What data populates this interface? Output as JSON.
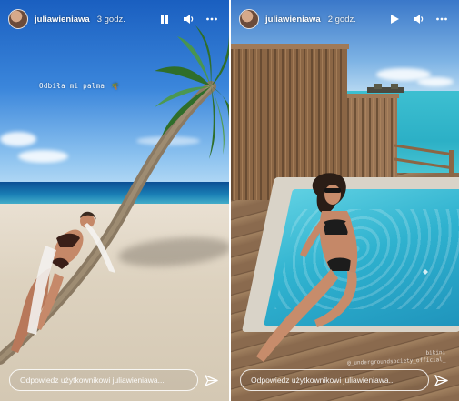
{
  "stories": [
    {
      "username": "juliawieniawa",
      "time": "3 godz.",
      "sticker_text": "Odbiła mi palma",
      "sticker_emoji": "🌴",
      "reply_placeholder": "Odpowiedz użytkownikowi juliawieniawa...",
      "controls": [
        "pause-icon",
        "sound-icon",
        "more-icon"
      ]
    },
    {
      "username": "juliawieniawa",
      "time": "2 godz.",
      "mention_line1": "bikini",
      "mention_line2": "@_undergroundsociety_official_",
      "reply_placeholder": "Odpowiedz użytkownikowi juliawieniawa...",
      "controls": [
        "play-icon",
        "sound-icon",
        "more-icon"
      ]
    }
  ]
}
